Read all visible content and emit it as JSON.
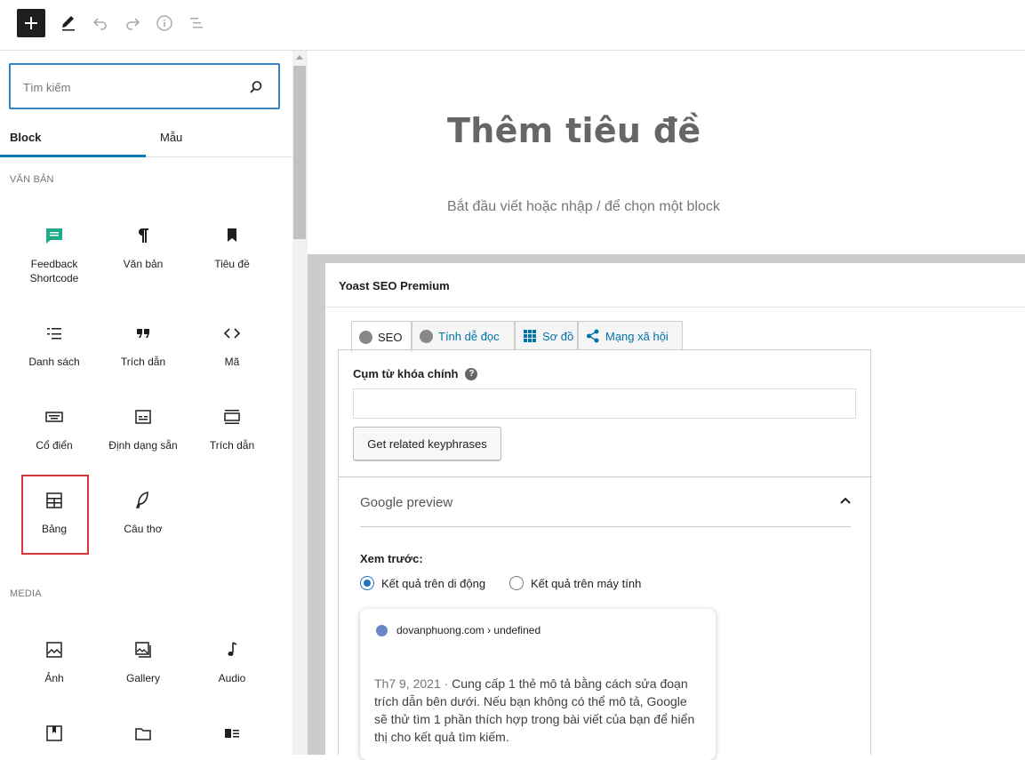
{
  "toolbar": {
    "add_icon": "plus-icon",
    "tools_icon": "pencil-icon",
    "undo_icon": "undo-icon",
    "redo_icon": "redo-icon",
    "info_icon": "info-icon",
    "outline_icon": "list-view-icon"
  },
  "inserter": {
    "search_placeholder": "Tìm kiếm",
    "tabs": [
      "Block",
      "Mẫu"
    ],
    "categories": {
      "text": "Văn bản",
      "media": "Media"
    },
    "text_blocks": [
      {
        "label": "Feedback Shortcode",
        "icon": "feedback-icon",
        "accent": "#2ea2cc"
      },
      {
        "label": "Văn bản",
        "icon": "paragraph-icon"
      },
      {
        "label": "Tiêu đề",
        "icon": "bookmark-icon"
      },
      {
        "label": "Danh sách",
        "icon": "list-icon"
      },
      {
        "label": "Trích dẫn",
        "icon": "quote-icon"
      },
      {
        "label": "Mã",
        "icon": "code-icon"
      },
      {
        "label": "Cổ điển",
        "icon": "keyboard-icon"
      },
      {
        "label": "Định dạng sẵn",
        "icon": "preformatted-icon"
      },
      {
        "label": "Trích dẫn",
        "icon": "pullquote-icon"
      },
      {
        "label": "Bảng",
        "icon": "table-icon"
      },
      {
        "label": "Câu thơ",
        "icon": "verse-icon"
      }
    ],
    "media_blocks": [
      {
        "label": "Ảnh",
        "icon": "image-icon"
      },
      {
        "label": "Gallery",
        "icon": "gallery-icon"
      },
      {
        "label": "Audio",
        "icon": "audio-icon"
      },
      {
        "label": "",
        "icon": "cover-icon"
      },
      {
        "label": "",
        "icon": "folder-icon"
      },
      {
        "label": "",
        "icon": "media-text-icon"
      }
    ]
  },
  "editor": {
    "title": "Thêm tiêu đề",
    "placeholder": "Bắt đầu viết hoặc nhập / để chọn một block"
  },
  "yoast": {
    "title": "Yoast SEO Premium",
    "tabs": [
      "SEO",
      "Tính dễ đọc",
      "Sơ đồ",
      "Mạng xã hội"
    ],
    "keyphrase_label": "Cụm từ khóa chính",
    "keyphrase_value": "",
    "related_button": "Get related keyphrases",
    "google_preview": "Google preview",
    "preview_label": "Xem trước:",
    "radio_mobile": "Kết quả trên di động",
    "radio_desktop": "Kết quả trên máy tính",
    "serp_url": "dovanphuong.com › undefined",
    "serp_date": "Th7 9, 2021 ·",
    "serp_desc": "Cung cấp 1 thẻ mô tả bằng cách sửa đoạn trích dẫn bên dưới. Nếu bạn không có thể mô tả, Google sẽ thử tìm 1 phần thích hợp trong bài viết của bạn để hiển thị cho kết quả tìm kiếm."
  }
}
